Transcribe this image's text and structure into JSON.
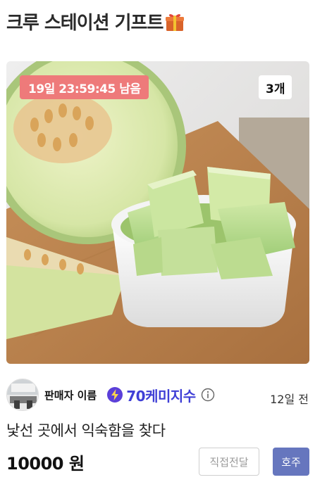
{
  "header": {
    "title": "크루 스테이션 기프트",
    "icon": "gift-icon"
  },
  "product": {
    "image": "melon-photo",
    "timer_text": "19일 23:59:45 남음",
    "count_text": "3개"
  },
  "seller": {
    "avatar": "avatar-photo",
    "name": "판매자 이름",
    "score_icon": "lightning-bolt-icon",
    "score_text": "70케미지수",
    "info_icon": "info-circle-icon",
    "time_ago": "12일 전"
  },
  "post": {
    "title": "낯선 곳에서 익숙함을 찾다",
    "price": "10000 원"
  },
  "tags": {
    "direct": "직접전달",
    "hoju": "호주"
  },
  "colors": {
    "timer_badge": "#ee7a7a",
    "score_text": "#3f3fd6",
    "hoju_tag": "#6676be"
  }
}
